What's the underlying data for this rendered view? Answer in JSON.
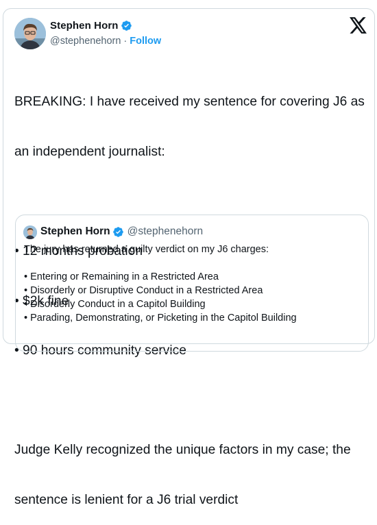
{
  "author": {
    "name": "Stephen Horn",
    "handle": "@stephenehorn",
    "separator": "·",
    "follow_label": "Follow",
    "verified_icon": "verified-badge-icon"
  },
  "tweet": {
    "line1": "BREAKING: I have received my sentence for covering J6 as",
    "line2": "an independent journalist:",
    "bullets": [
      "• 12 months probation",
      "• $2k fine",
      "• 90 hours community service"
    ],
    "line3": "Judge Kelly recognized the unique factors in my case; the",
    "line4": "sentence is lenient for a J6 trial verdict"
  },
  "quote": {
    "name": "Stephen Horn",
    "handle": "@stephenehorn",
    "intro": "The jury has returned a guilty verdict on my J6 charges:",
    "bullets": [
      "• Entering or Remaining in a Restricted Area",
      "• Disorderly or Disruptive Conduct in a Restricted Area",
      "• Disorderly Conduct in a Capitol Building",
      "• Parading, Demonstrating, or Picketing in the Capitol Building"
    ]
  },
  "colors": {
    "accent": "#1d9bf0",
    "secondary_text": "#536471",
    "border": "#cfd9de"
  }
}
